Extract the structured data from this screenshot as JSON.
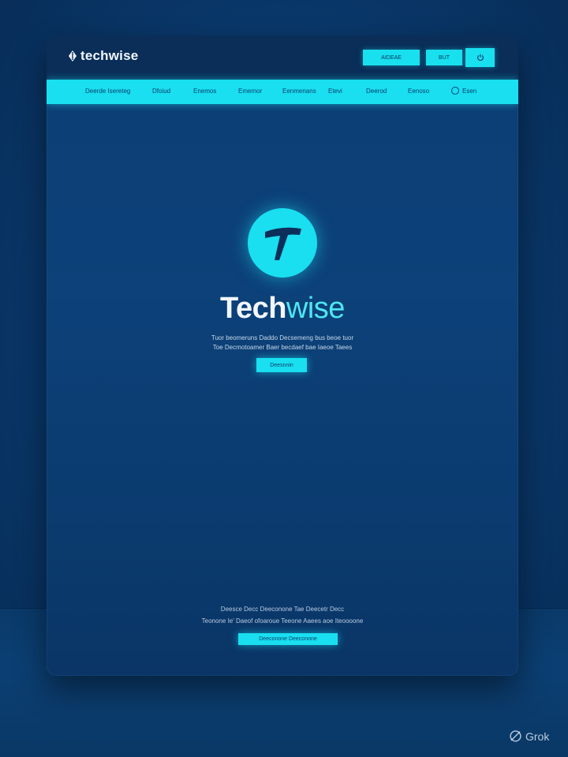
{
  "colors": {
    "accent": "#19dff0",
    "background": "#0a3a6e",
    "header": "#0a2e58",
    "text_on_accent": "#0b3f6e"
  },
  "header": {
    "brand_name": "techwise",
    "brand_icon": "diamond-leaf-icon",
    "buttons": [
      {
        "label": "AIDEAE"
      },
      {
        "label": "BUT"
      },
      {
        "label": "",
        "icon": "power-icon"
      }
    ]
  },
  "nav": {
    "items": [
      {
        "label": "Deerde Isereteg"
      },
      {
        "label": "Dfoiud"
      },
      {
        "label": "Enemos"
      },
      {
        "label": "Ememor"
      },
      {
        "label": "Eenmenans"
      },
      {
        "label": "Etevi"
      },
      {
        "label": "Deerod"
      },
      {
        "label": "Eenoso"
      },
      {
        "label": "Esen",
        "icon": "circle-icon"
      }
    ]
  },
  "hero": {
    "logo_icon": "t-logo-icon",
    "title_strong": "Tech",
    "title_accent": "wise",
    "line_1": "Tuor beomeruns Daddo Decsemeng bus beoe tuor",
    "line_2": "Toe Decmotoamer Baer becdaef bae Iaeoe Taees",
    "cta_label": "Deesnnin"
  },
  "footer": {
    "line_1": "Deesce Decc Deeconone Tae Deecetr Decc",
    "line_2": "Teonone Ie' Daeof ofoaroue Teeone Aaees aoe Iteoooone",
    "cta_label": "Deeconone Deeconone"
  },
  "watermark": {
    "label": "Grok",
    "icon": "grok-icon"
  }
}
